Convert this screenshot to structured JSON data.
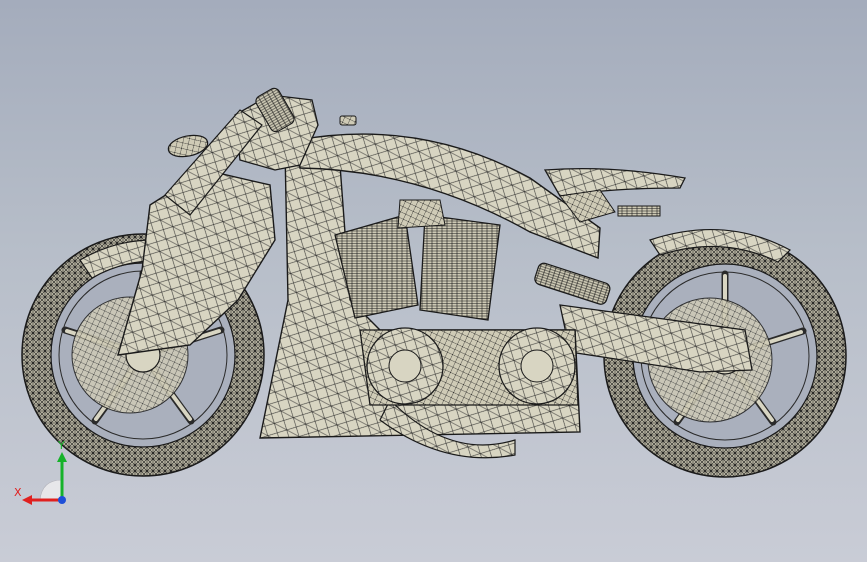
{
  "viewport": {
    "background_top": "#a4acbc",
    "background_bottom": "#c9ccd6",
    "model": {
      "subject": "motorcycle-wireframe-model",
      "display_mode": "shaded-with-edges",
      "body_fill": "#d8d5c2",
      "edge_color": "#1c1c1c"
    }
  },
  "triad": {
    "x_label": "X",
    "y_label": "Y",
    "x_color": "#e0201f",
    "y_color": "#16b22a",
    "z_color": "#1e4fd8"
  }
}
